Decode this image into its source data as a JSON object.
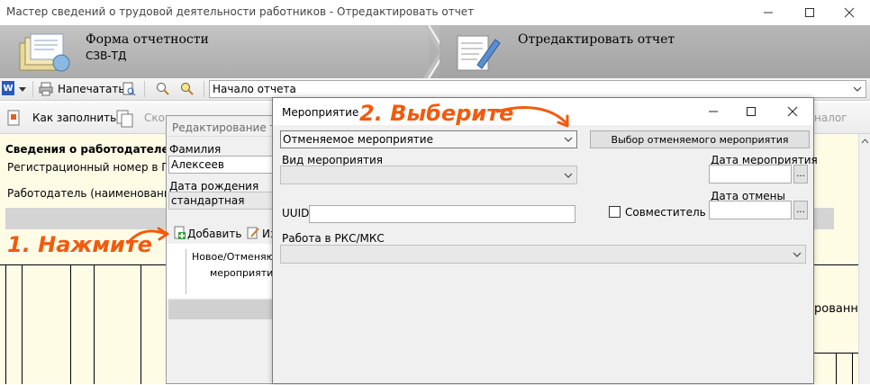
{
  "window": {
    "title": "Мастер сведений о трудовой деятельности работников - Отредактировать отчет"
  },
  "header": {
    "step1_title": "Форма отчетности",
    "step1_subtitle": "СЗВ-ТД",
    "step2_title": "Отредактировать отчет"
  },
  "toolbar": {
    "print_label": "Напечатать",
    "location_value": "Начало отчета"
  },
  "toolbar2": {
    "how_to_fill_label": "Как заполнить",
    "partial_label": "Ско",
    "partial_right_label": "налог"
  },
  "main": {
    "employer_info_heading": "Сведения о работодателе, пр",
    "reg_number_label": "Регистрационный номер в ПФ",
    "employer_name_label": "Работодатель (наименование)",
    "right_partial_text": "рованно"
  },
  "edit_window": {
    "title": "Редактирование тру",
    "surname_label": "Фамилия",
    "surname_value": "Алексеев",
    "birthdate_label": "Дата рождения",
    "birthdate_value": "стандартная",
    "add_label": "Добавить",
    "edit_partial_label": "Из",
    "list_item_line1": "Новое/Отменяющ",
    "list_item_line2": "мероприятие"
  },
  "dialog": {
    "title": "Мероприятие",
    "event_select_value": "Отменяемое мероприятие",
    "choose_cancelled_label": "Выбор отменяемого мероприятия",
    "event_type_label": "Вид мероприятия",
    "event_date_label": "Дата мероприятия",
    "cancel_date_label": "Дата отмены",
    "uuid_label": "UUID",
    "part_time_label": "Совместитель",
    "part_time_checked": false,
    "rks_label": "Работа в РКС/МКС",
    "dots_label": "..."
  },
  "annotations": {
    "step1": "1. Нажмите",
    "step2": "2. Выберите",
    "color": "#f25a0e"
  }
}
